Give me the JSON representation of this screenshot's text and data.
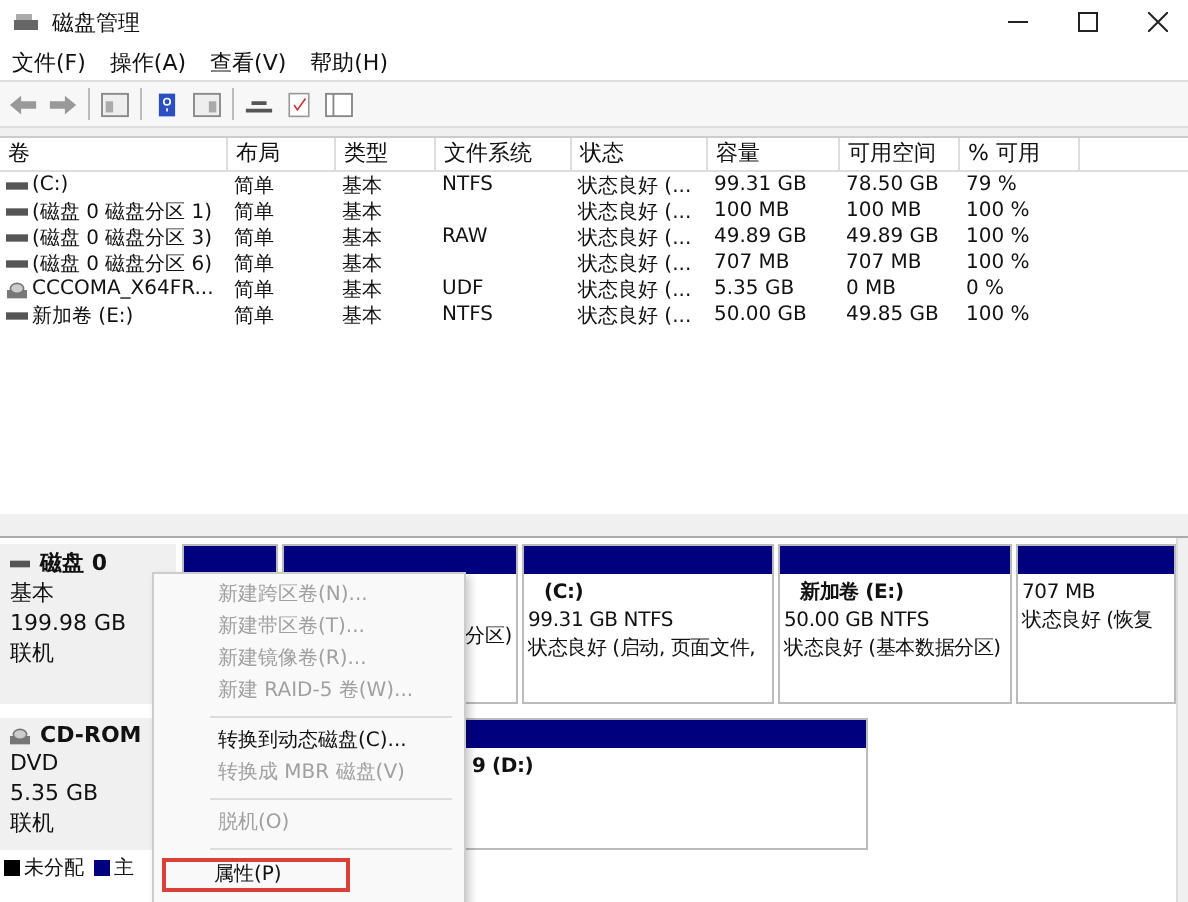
{
  "window": {
    "title": "磁盘管理"
  },
  "menu": [
    "文件(F)",
    "操作(A)",
    "查看(V)",
    "帮助(H)"
  ],
  "table": {
    "columns": [
      "卷",
      "布局",
      "类型",
      "文件系统",
      "状态",
      "容量",
      "可用空间",
      "% 可用"
    ],
    "rows": [
      {
        "kind": "disk",
        "cells": [
          "(C:)",
          "简单",
          "基本",
          "NTFS",
          "状态良好 (...",
          "99.31 GB",
          "78.50 GB",
          "79 %"
        ]
      },
      {
        "kind": "disk",
        "cells": [
          "(磁盘 0 磁盘分区 1)",
          "简单",
          "基本",
          "",
          "状态良好 (...",
          "100 MB",
          "100 MB",
          "100 %"
        ]
      },
      {
        "kind": "disk",
        "cells": [
          "(磁盘 0 磁盘分区 3)",
          "简单",
          "基本",
          "RAW",
          "状态良好 (...",
          "49.89 GB",
          "49.89 GB",
          "100 %"
        ]
      },
      {
        "kind": "disk",
        "cells": [
          "(磁盘 0 磁盘分区 6)",
          "简单",
          "基本",
          "",
          "状态良好 (...",
          "707 MB",
          "707 MB",
          "100 %"
        ]
      },
      {
        "kind": "cd",
        "cells": [
          "CCCOMA_X64FR...",
          "简单",
          "基本",
          "UDF",
          "状态良好 (...",
          "5.35 GB",
          "0 MB",
          "0 %"
        ]
      },
      {
        "kind": "disk",
        "cells": [
          "新加卷 (E:)",
          "简单",
          "基本",
          "NTFS",
          "状态良好 (...",
          "50.00 GB",
          "49.85 GB",
          "100 %"
        ]
      }
    ]
  },
  "disks": [
    {
      "kind": "disk",
      "name": "磁盘 0",
      "lines": [
        "基本",
        "199.98 GB",
        "联机"
      ],
      "partitions": [
        {
          "kind": "primary"
        },
        {
          "kind": "primary",
          "lines": [
            "分区)"
          ]
        },
        {
          "kind": "primary",
          "lines": [
            "(C:)",
            "99.31 GB NTFS",
            "状态良好 (启动, 页面文件,"
          ]
        },
        {
          "kind": "primary",
          "lines": [
            "新加卷  (E:)",
            "50.00 GB NTFS",
            "状态良好 (基本数据分区)"
          ]
        },
        {
          "kind": "primary",
          "lines": [
            "707 MB",
            "状态良好 (恢复"
          ]
        }
      ]
    },
    {
      "kind": "cd",
      "name": "CD-ROM",
      "lines": [
        "DVD",
        "5.35 GB",
        "联机"
      ],
      "partitions": [
        {
          "kind": "primary",
          "lines": [
            "9  (D:)"
          ]
        }
      ]
    }
  ],
  "legend": [
    {
      "label": "未分配",
      "color": "#000000"
    },
    {
      "label": "主",
      "color": "#00007f"
    }
  ],
  "context_menu": [
    {
      "kind": "item",
      "label": "新建跨区卷(N)...",
      "disabled": true,
      "highlighted": false
    },
    {
      "kind": "item",
      "label": "新建带区卷(T)...",
      "disabled": true,
      "highlighted": false
    },
    {
      "kind": "item",
      "label": "新建镜像卷(R)...",
      "disabled": true,
      "highlighted": false
    },
    {
      "kind": "item",
      "label": "新建 RAID-5 卷(W)...",
      "disabled": true,
      "highlighted": false
    },
    {
      "kind": "separator"
    },
    {
      "kind": "item",
      "label": "转换到动态磁盘(C)...",
      "disabled": false,
      "highlighted": false
    },
    {
      "kind": "item",
      "label": "转换成 MBR 磁盘(V)",
      "disabled": true,
      "highlighted": false
    },
    {
      "kind": "separator"
    },
    {
      "kind": "item",
      "label": "脱机(O)",
      "disabled": true,
      "highlighted": false
    },
    {
      "kind": "separator"
    },
    {
      "kind": "item",
      "label": "属性(P)",
      "disabled": false,
      "highlighted": true
    }
  ]
}
